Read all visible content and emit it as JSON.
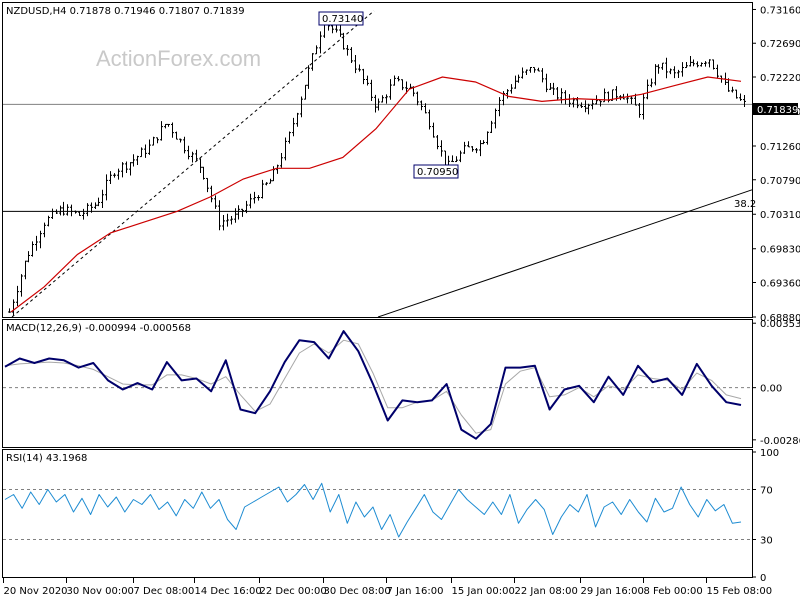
{
  "watermark": "ActionForex.com",
  "price_pane": {
    "header": "NZDUSD,H4  0.71878 0.71946 0.71807 0.71839",
    "current_price_label": "0.71839",
    "fib_label": "38.2",
    "annotations": [
      {
        "text": "0.73140",
        "x": "1 Jan 00:00",
        "y": 0.7314
      },
      {
        "text": "0.70950",
        "x": "14 Jan 00:00",
        "y": 0.7095
      }
    ]
  },
  "macd_pane": {
    "header": "MACD(12,26,9) -0.000994 -0.000568"
  },
  "rsi_pane": {
    "header": "RSI(14) 43.1968"
  },
  "colors": {
    "candles": "#000000",
    "sma": "#cc0000",
    "macd_line": "#00006b",
    "signal_line": "#a8a8a8",
    "rsi_line": "#1e8cd2",
    "reference": "#808080",
    "grid_frame": "#000000"
  },
  "chart_data": [
    {
      "type": "candlestick",
      "title": "NZDUSD,H4",
      "x_ticks": [
        "20 Nov 2020",
        "30 Nov 00:00",
        "7 Dec 08:00",
        "14 Dec 16:00",
        "22 Dec 00:00",
        "30 Dec 08:00",
        "7 Jan 16:00",
        "15 Jan 00:00",
        "22 Jan 08:00",
        "29 Jan 16:00",
        "8 Feb 00:00",
        "15 Feb 08:00"
      ],
      "y_ticks": [
        "0.73160",
        "0.72690",
        "0.72220",
        "0.71750",
        "0.71260",
        "0.70790",
        "0.70310",
        "0.69830",
        "0.69360",
        "0.68880"
      ],
      "ylim": [
        0.6888,
        0.7325
      ],
      "grid": false,
      "series": [
        {
          "name": "",
          "x": [
            "20 Nov 2020",
            "24 Nov",
            "27 Nov",
            "1 Dec",
            "4 Dec",
            "7 Dec",
            "10 Dec",
            "12 Dec",
            "14 Dec",
            "16 Dec",
            "18 Dec",
            "20 Dec",
            "21 Dec",
            "22 Dec",
            "23 Dec",
            "25 Dec",
            "28 Dec",
            "30 Dec",
            "1 Jan",
            "3 Jan",
            "5 Jan",
            "7 Jan",
            "9 Jan",
            "11 Jan",
            "13 Jan",
            "14 Jan",
            "15 Jan",
            "16 Jan",
            "18 Jan",
            "20 Jan",
            "22 Jan",
            "24 Jan",
            "27 Jan",
            "29 Jan",
            "1 Feb",
            "3 Feb",
            "5 Feb",
            "8 Feb",
            "10 Feb",
            "12 Feb",
            "14 Feb",
            "15 Feb",
            "17 Feb"
          ],
          "close": [
            0.6895,
            0.6972,
            0.702,
            0.7038,
            0.703,
            0.7046,
            0.7092,
            0.7105,
            0.7125,
            0.716,
            0.7125,
            0.7095,
            0.702,
            0.7028,
            0.7055,
            0.708,
            0.714,
            0.7222,
            0.7302,
            0.7272,
            0.7228,
            0.718,
            0.7215,
            0.7205,
            0.716,
            0.7095,
            0.712,
            0.713,
            0.719,
            0.722,
            0.7235,
            0.72,
            0.719,
            0.7185,
            0.7195,
            0.72,
            0.7175,
            0.724,
            0.7225,
            0.724,
            0.7248,
            0.7205,
            0.7184
          ]
        },
        {
          "name": "",
          "x": [
            "20 Nov 2020",
            "24 Nov",
            "27 Nov",
            "1 Dec",
            "4 Dec",
            "7 Dec",
            "10 Dec",
            "14 Dec",
            "18 Dec",
            "22 Dec",
            "25 Dec",
            "30 Dec",
            "3 Jan",
            "7 Jan",
            "11 Jan",
            "15 Jan",
            "20 Jan",
            "24 Jan",
            "29 Jan",
            "3 Feb",
            "8 Feb",
            "12 Feb",
            "17 Feb"
          ],
          "values": [
            0.6895,
            0.693,
            0.6975,
            0.7005,
            0.702,
            0.7035,
            0.7055,
            0.708,
            0.7095,
            0.7095,
            0.711,
            0.715,
            0.7205,
            0.7222,
            0.7215,
            0.7195,
            0.7188,
            0.7192,
            0.719,
            0.7198,
            0.721,
            0.7222,
            0.7216
          ]
        }
      ],
      "reference_lines": [
        {
          "label": "0.71839",
          "y": 0.71839
        },
        {
          "label": "38.2",
          "y": 0.7035
        },
        {
          "label": "",
          "x": [
            "20 Nov 2020",
            "30 Dec 08:00"
          ],
          "y": [
            0.6888,
            0.7314
          ]
        },
        {
          "label": "",
          "x": [
            "30 Dec 08:00",
            "17 Feb 12:00"
          ],
          "y": [
            0.6888,
            0.7065
          ]
        }
      ]
    },
    {
      "type": "line",
      "title": "MACD(12,26,9)",
      "x_ticks": [
        "20 Nov 2020",
        "30 Nov 00:00",
        "7 Dec 08:00",
        "14 Dec 16:00",
        "22 Dec 00:00",
        "30 Dec 08:00",
        "7 Jan 16:00",
        "15 Jan 00:00",
        "22 Jan 08:00",
        "29 Jan 16:00",
        "8 Feb 00:00",
        "15 Feb 08:00"
      ],
      "y_ticks": [
        "0.003534",
        "0.00",
        "-0.002862"
      ],
      "ylim": [
        -0.0032,
        0.0036
      ],
      "series": [
        {
          "name": "",
          "values": [
            0.00115,
            0.0016,
            0.00135,
            0.0016,
            0.0015,
            0.0011,
            0.00135,
            0.0004,
            -0.0001,
            0.00025,
            -0.0001,
            0.0014,
            0.0004,
            0.0005,
            -0.0002,
            0.0015,
            -0.0012,
            -0.0014,
            -0.0002,
            0.0014,
            0.0026,
            0.0025,
            0.0016,
            0.0031,
            0.002,
            0.0002,
            -0.0018,
            -0.0007,
            -0.0008,
            -0.0007,
            0.0002,
            -0.0023,
            -0.0028,
            -0.002,
            0.0011,
            0.0011,
            0.0012,
            -0.0012,
            -0.0001,
            0.0001,
            -0.0008,
            0.0006,
            -0.0004,
            0.0012,
            0.0003,
            0.0005,
            -0.0004,
            0.0013,
            0.0001,
            -0.0008,
            -0.00095
          ]
        },
        {
          "name": "",
          "values": [
            0.0012,
            0.0013,
            0.00135,
            0.0014,
            0.00135,
            0.0012,
            0.001,
            0.0006,
            0.0002,
            0.00015,
            0.00015,
            0.0007,
            0.0007,
            0.0005,
            0.0002,
            0.0006,
            -0.0004,
            -0.0013,
            -0.0009,
            0.0005,
            0.0019,
            0.0024,
            0.0019,
            0.0026,
            0.0024,
            0.0008,
            -0.0011,
            -0.0011,
            -0.0008,
            -0.0007,
            -0.0002,
            -0.0015,
            -0.0025,
            -0.0023,
            0.0002,
            0.0009,
            0.0011,
            -0.0005,
            -0.0004,
            0.0,
            -0.0005,
            0.0001,
            -0.0001,
            0.0007,
            0.0005,
            0.0004,
            -0.0001,
            0.0008,
            0.0004,
            -0.0004,
            -0.0006
          ]
        }
      ],
      "reference_lines": [
        {
          "label": "",
          "y": 0.0
        }
      ]
    },
    {
      "type": "line",
      "title": "RSI(14)",
      "x_ticks": [
        "20 Nov 2020",
        "30 Nov 00:00",
        "7 Dec 08:00",
        "14 Dec 16:00",
        "22 Dec 00:00",
        "30 Dec 08:00",
        "7 Jan 16:00",
        "15 Jan 00:00",
        "22 Jan 08:00",
        "29 Jan 16:00",
        "8 Feb 00:00",
        "15 Feb 08:00"
      ],
      "y_ticks": [
        "100",
        "70",
        "30",
        "0"
      ],
      "ylim": [
        0,
        100
      ],
      "series": [
        {
          "name": "",
          "values": [
            62,
            66,
            55,
            68,
            58,
            70,
            60,
            66,
            52,
            63,
            50,
            66,
            56,
            64,
            52,
            62,
            58,
            66,
            54,
            60,
            49,
            62,
            55,
            68,
            55,
            62,
            46,
            38,
            56,
            60,
            64,
            68,
            72,
            60,
            66,
            74,
            62,
            75,
            52,
            66,
            43,
            60,
            48,
            56,
            38,
            50,
            32,
            44,
            55,
            66,
            52,
            46,
            58,
            70,
            62,
            56,
            50,
            60,
            50,
            66,
            43,
            54,
            62,
            54,
            34,
            48,
            58,
            52,
            66,
            40,
            56,
            60,
            50,
            62,
            52,
            44,
            63,
            52,
            55,
            72,
            58,
            48,
            62,
            53,
            58,
            43,
            44
          ]
        }
      ],
      "reference_lines": [
        {
          "label": "70",
          "y": 70
        },
        {
          "label": "30",
          "y": 30
        }
      ]
    }
  ]
}
